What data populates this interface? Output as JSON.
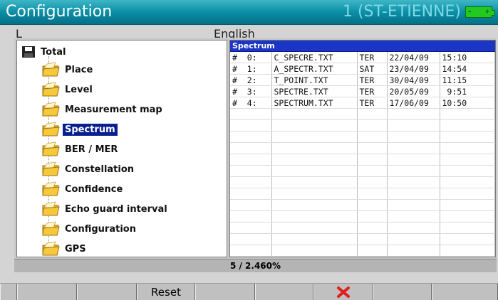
{
  "header": {
    "title": "Configuration",
    "site": "1 (ST-ETIENNE)"
  },
  "background_text": {
    "left": "L",
    "middle": "English"
  },
  "tree": {
    "root": "Total",
    "items": [
      {
        "label": "Place"
      },
      {
        "label": "Level"
      },
      {
        "label": "Measurement map"
      },
      {
        "label": "Spectrum",
        "selected": true
      },
      {
        "label": "BER / MER"
      },
      {
        "label": "Constellation"
      },
      {
        "label": "Confidence"
      },
      {
        "label": "Echo guard interval"
      },
      {
        "label": "Configuration"
      },
      {
        "label": "GPS"
      }
    ]
  },
  "file_list": {
    "header": "Spectrum",
    "rows": [
      {
        "index": "#  0:",
        "name": "C_SPECRE.TXT",
        "type": "TER",
        "date": "22/04/09",
        "time": "15:10"
      },
      {
        "index": "#  1:",
        "name": "A_SPECTR.TXT",
        "type": "SAT",
        "date": "23/04/09",
        "time": "14:54"
      },
      {
        "index": "#  2:",
        "name": "T_POINT.TXT",
        "type": "TER",
        "date": "30/04/09",
        "time": "11:15"
      },
      {
        "index": "#  3:",
        "name": "SPECTRE.TXT",
        "type": "TER",
        "date": "20/05/09",
        "time": " 9:51"
      },
      {
        "index": "#  4:",
        "name": "SPECTRUM.TXT",
        "type": "TER",
        "date": "17/06/09",
        "time": "10:50"
      }
    ]
  },
  "status": {
    "text": "5 /  2.460%"
  },
  "function_keys": [
    "",
    "",
    "Reset",
    "",
    "",
    "cancel-icon",
    "",
    ""
  ],
  "colors": {
    "title_bar": "#0a8fa6",
    "selection": "#0a1f8f",
    "list_header": "#1b36c4",
    "cancel": "#e0201a",
    "battery": "#22c91e"
  }
}
